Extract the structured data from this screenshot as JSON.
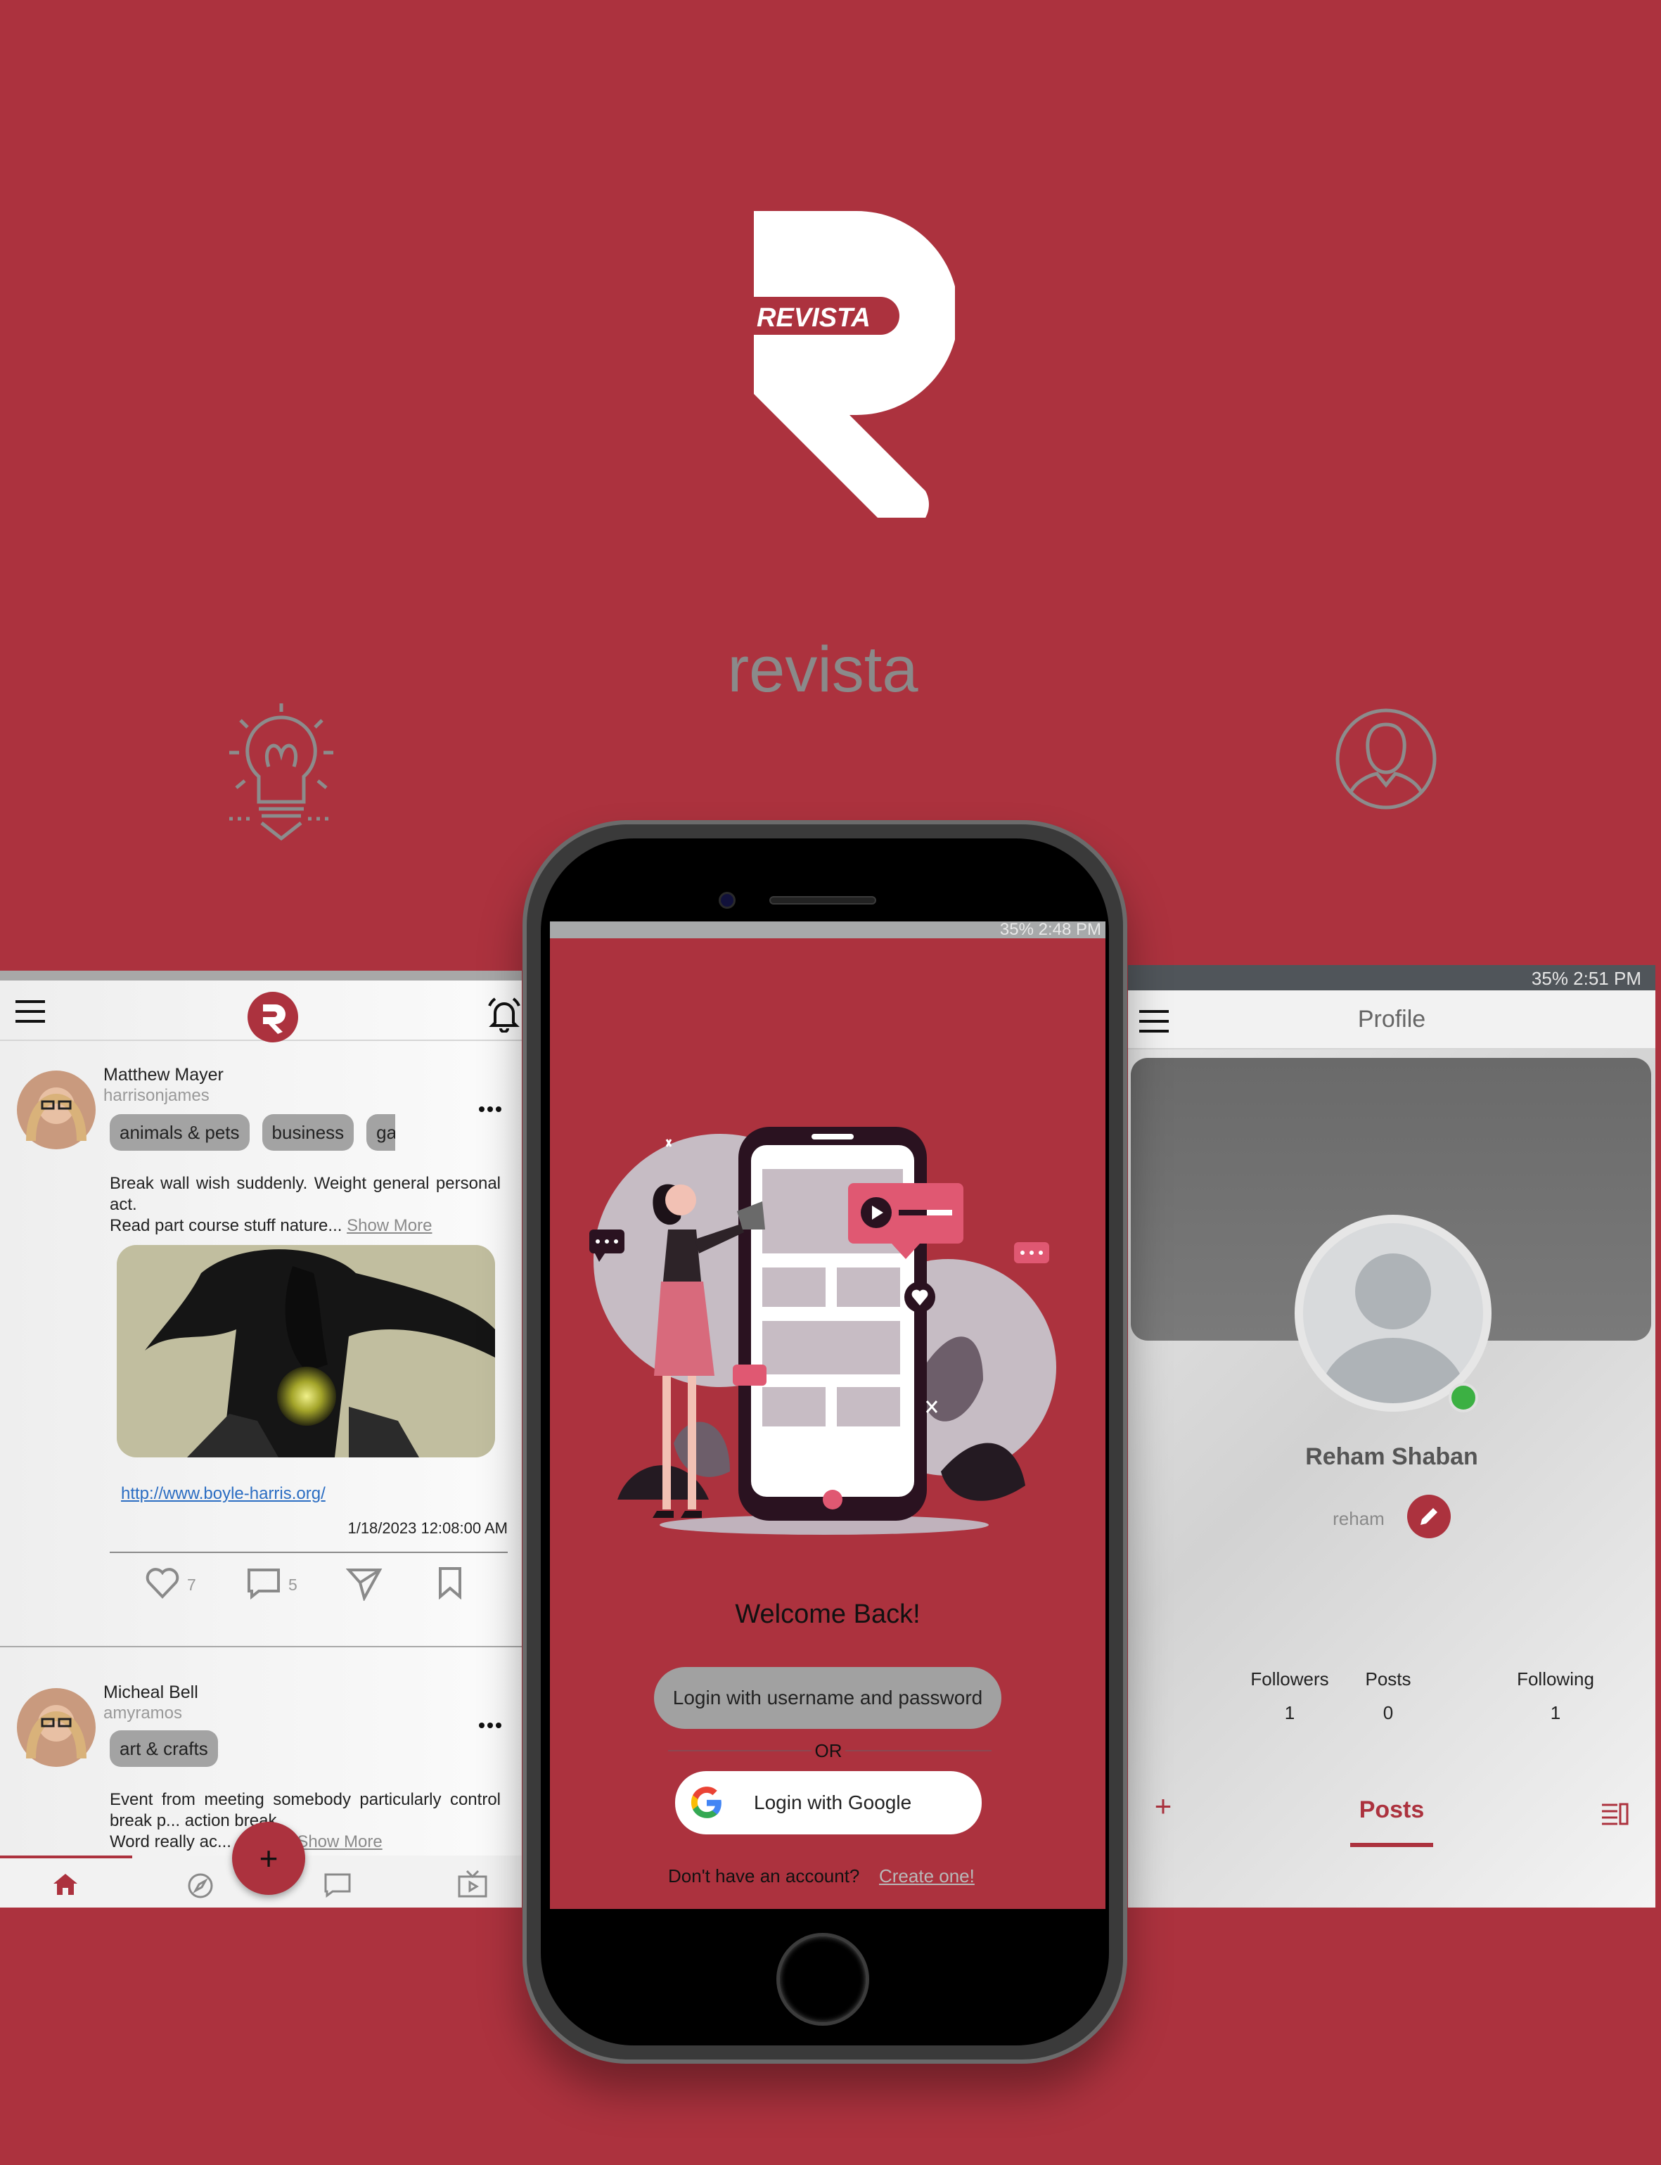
{
  "brand": {
    "logo_text": "REVISTA",
    "wordmark": "revista",
    "background_color": "#ac323e",
    "icons": [
      "lightbulb-icon",
      "user-profile-icon"
    ]
  },
  "feed": {
    "posts": [
      {
        "name": "Matthew Mayer",
        "handle": "harrisonjames",
        "tags": [
          "animals & pets",
          "business",
          "gan"
        ],
        "body_main": "Break wall wish suddenly. Weight general personal act.",
        "body_second": "Read part course stuff nature...",
        "show_more": "Show More",
        "link": "http://www.boyle-harris.org/",
        "date": "1/18/2023 12:08:00 AM",
        "likes": "7",
        "comments": "5"
      },
      {
        "name": "Micheal Bell",
        "handle": "amyramos",
        "tags": [
          "art & crafts"
        ],
        "body_main": "Event from meeting somebody particularly control break p... action break.",
        "body_second": "Word really ac... erybo...",
        "show_more": "Show More"
      }
    ],
    "fab_label": "+",
    "nav": [
      "home-icon",
      "explore-icon",
      "chat-icon",
      "tv-icon"
    ]
  },
  "login": {
    "status_text": "35% 2:48 PM",
    "welcome": "Welcome Back!",
    "username_button": "Login with username and password",
    "or": "OR",
    "google_button": "Login with Google",
    "no_account": "Don't have an account?",
    "create_link": "Create one!"
  },
  "profile": {
    "status_text": "35% 2:51 PM",
    "title": "Profile",
    "name": "Reham Shaban",
    "username": "reham",
    "stats": [
      {
        "label": "Followers",
        "value": "1"
      },
      {
        "label": "Posts",
        "value": "0"
      },
      {
        "label": "Following",
        "value": "1"
      }
    ],
    "tab_add": "+",
    "tab_posts": "Posts"
  }
}
